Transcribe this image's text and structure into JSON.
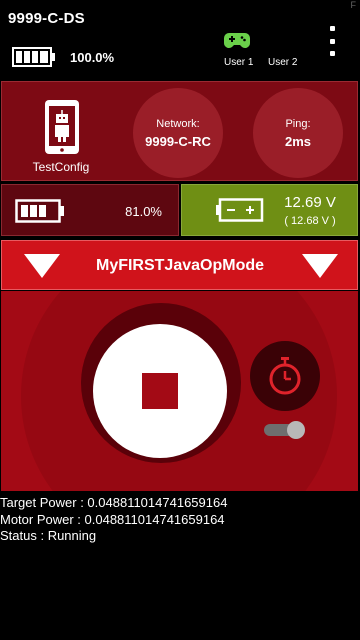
{
  "header": {
    "app_title": "9999-C-DS",
    "corner_mark": "F",
    "ds_battery_pct": "100.0%",
    "users": [
      "User 1",
      "User 2"
    ],
    "icons": {
      "battery": "battery-full-icon",
      "gamepad": "gamepad-icon",
      "menu": "kebab-menu-icon"
    }
  },
  "config": {
    "label": "TestConfig"
  },
  "network": {
    "label": "Network:",
    "value": "9999-C-RC"
  },
  "ping": {
    "label": "Ping:",
    "value": "2ms"
  },
  "robot_battery": {
    "pct": "81.0%"
  },
  "voltage": {
    "main": "12.69 V",
    "sub": "( 12.68 V )"
  },
  "opmode": {
    "name": "MyFIRSTJavaOpMode"
  },
  "telemetry": [
    "Target Power : 0.048811014741659164",
    "Motor Power : 0.048811014741659164",
    "Status : Running"
  ],
  "colors": {
    "panel_dark_red": "#7d0a14",
    "opmode_red": "#d0131b",
    "control_red": "#a30a15",
    "voltage_green": "#6f8f14",
    "gamepad_green": "#6ad04a"
  }
}
